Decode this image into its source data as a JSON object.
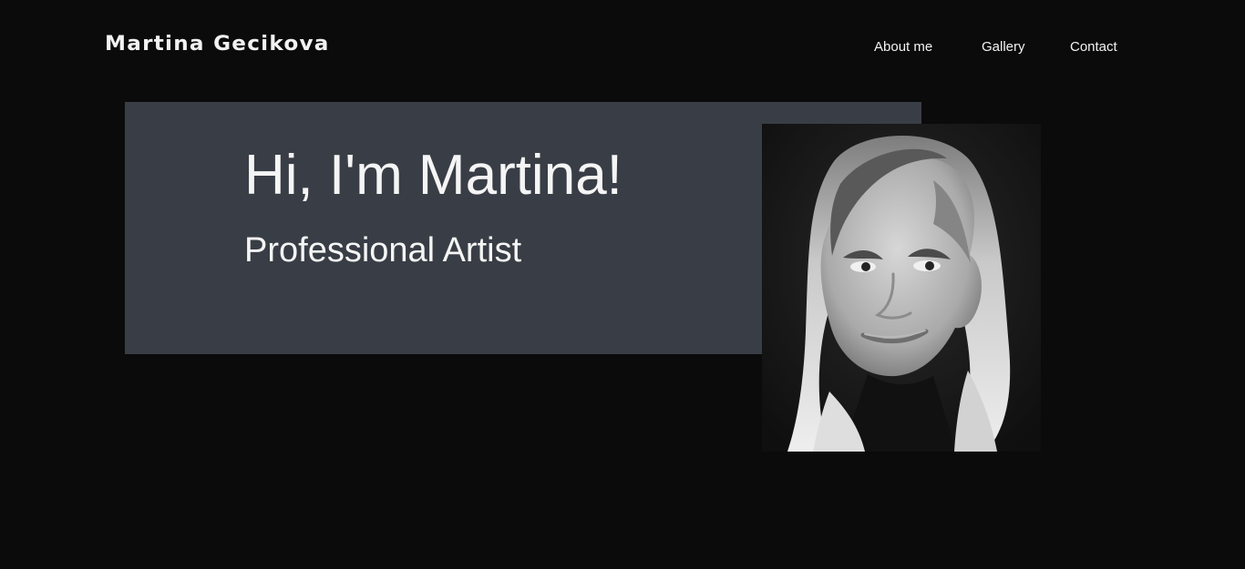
{
  "header": {
    "brand": "Martina Gecikova",
    "nav": [
      {
        "label": "About me"
      },
      {
        "label": "Gallery"
      },
      {
        "label": "Contact"
      }
    ]
  },
  "hero": {
    "title": "Hi, I'm Martina!",
    "subtitle": "Professional Artist"
  },
  "colors": {
    "page_background": "#0b0b0b",
    "hero_box": "#393e46",
    "text": "#f5f5f5"
  }
}
